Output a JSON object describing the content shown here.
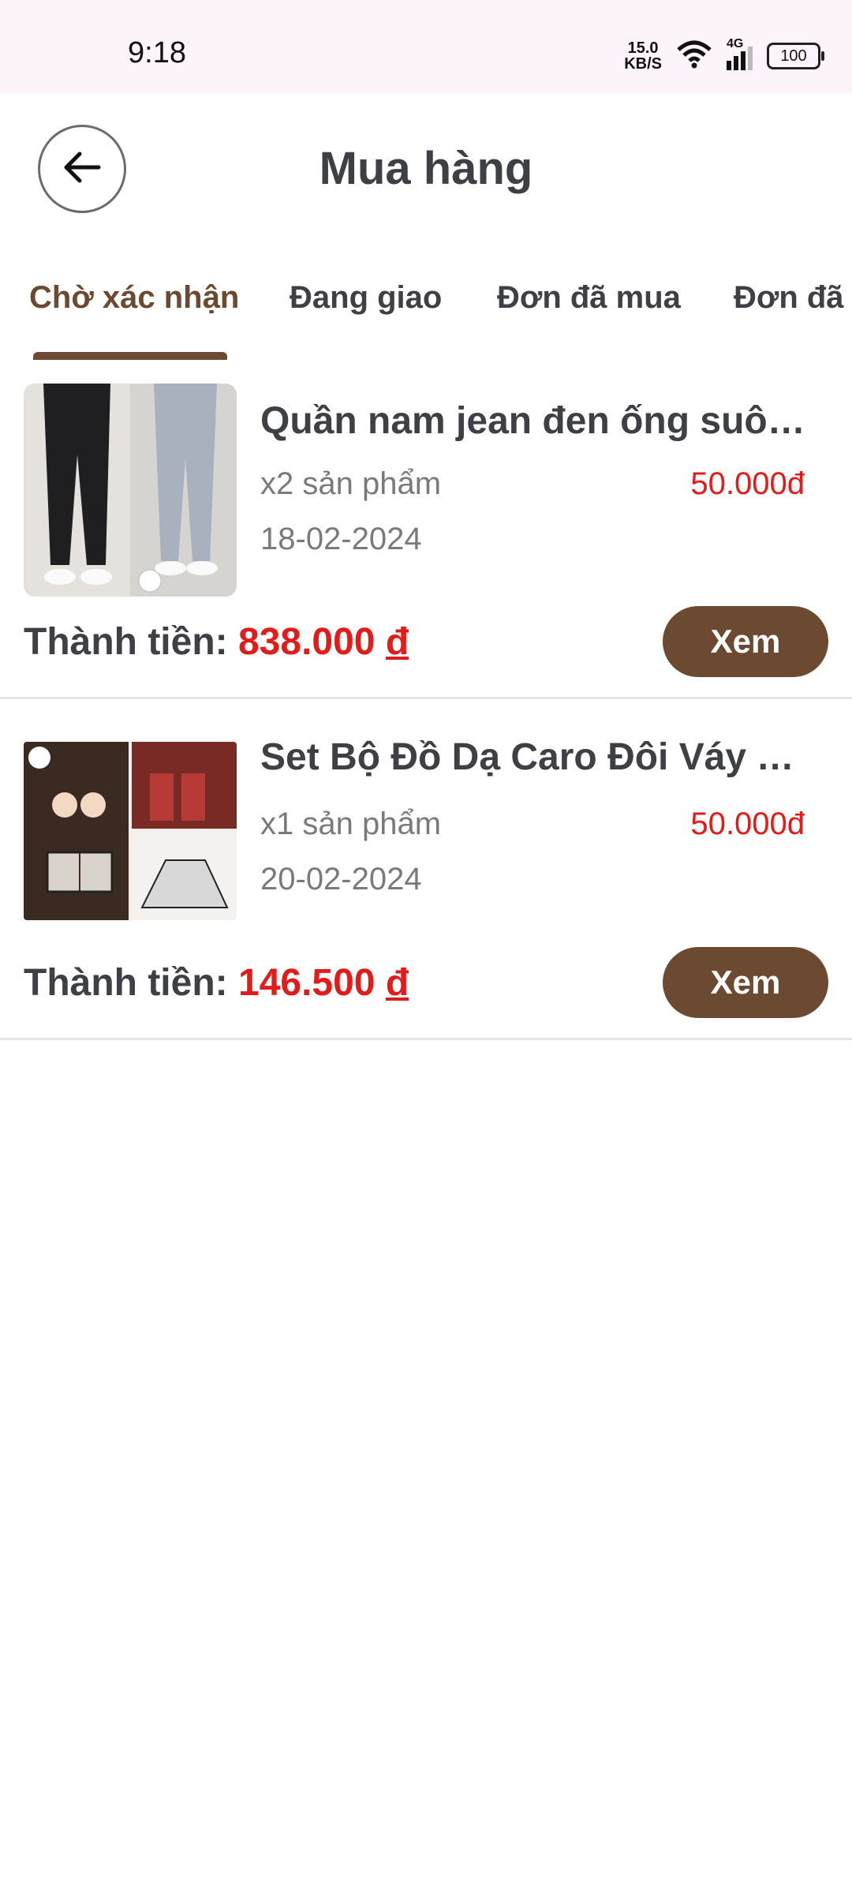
{
  "status_bar": {
    "time": "9:18",
    "net_speed_value": "15.0",
    "net_speed_unit": "KB/S",
    "network": "4G",
    "battery": "100"
  },
  "header": {
    "title": "Mua hàng",
    "back_icon": "arrow-left-icon"
  },
  "tabs": [
    {
      "label": "Chờ xác nhận",
      "active": true
    },
    {
      "label": "Đang giao",
      "active": false
    },
    {
      "label": "Đơn đã mua",
      "active": false
    },
    {
      "label": "Đơn đã h",
      "active": false
    }
  ],
  "orders": [
    {
      "name": "Quần nam jean đen ống suông",
      "quantity": "x2 sản phẩm",
      "unit_price": "50.000đ",
      "date": "18-02-2024",
      "total_label": "Thành tiền:",
      "total_amount": "838.000",
      "currency": "đ",
      "view_label": "Xem"
    },
    {
      "name": "Set Bộ Đồ Dạ Caro Đôi Váy Yếm",
      "quantity": "x1 sản phẩm",
      "unit_price": "50.000đ",
      "date": "20-02-2024",
      "total_label": "Thành tiền:",
      "total_amount": "146.500",
      "currency": "đ",
      "view_label": "Xem"
    }
  ],
  "colors": {
    "accent_brown": "#6b4a31",
    "price_red": "#e21b1b",
    "status_bar_bg": "#fdf3fb"
  }
}
